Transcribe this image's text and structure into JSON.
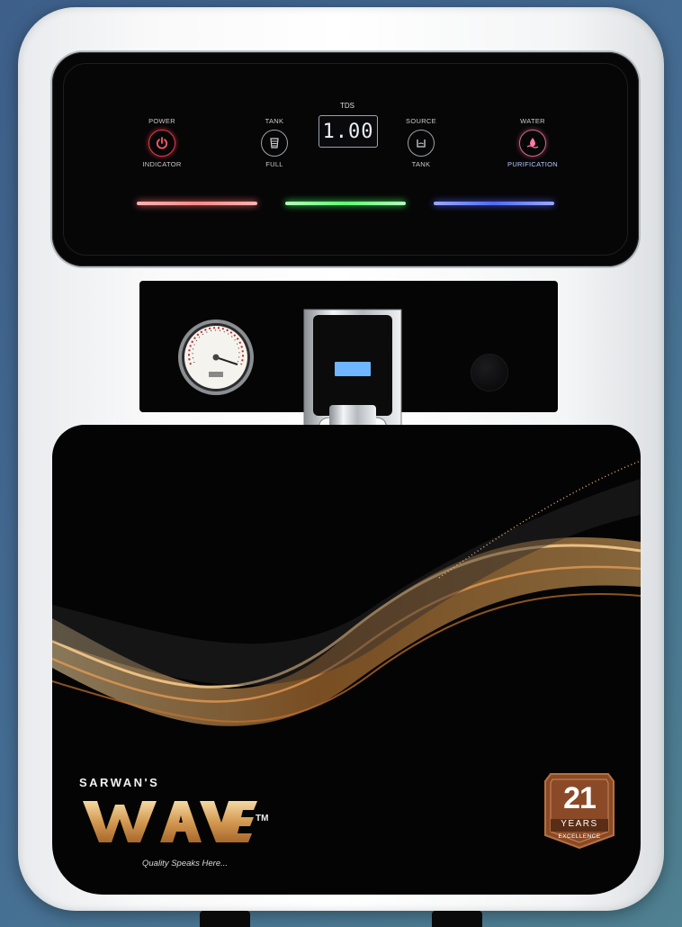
{
  "controls": {
    "power": {
      "top_label": "POWER",
      "bottom_label": "INDICATOR"
    },
    "tank": {
      "top_label": "TANK",
      "bottom_label": "FULL"
    },
    "tds": {
      "label": "TDS",
      "value": "1.00"
    },
    "source": {
      "top_label": "SOURCE",
      "bottom_label": "TANK"
    },
    "water": {
      "top_label": "WATER",
      "bottom_label": "PURIFICATION"
    }
  },
  "status_bars": {
    "colors": [
      "#ff8a8a",
      "#7dff8a",
      "#5f7bff"
    ]
  },
  "brand": {
    "prefix": "SARWAN'S",
    "name": "WAVE",
    "trademark": "TM",
    "tagline": "Quality Speaks Here..."
  },
  "badge": {
    "number": "21",
    "line1": "YEARS",
    "line2": "EXCELLENCE"
  },
  "colors": {
    "body": "#ffffff",
    "panel": "#060607",
    "accent_gold": "#d9a45a",
    "badge_brown": "#8a4a28"
  }
}
